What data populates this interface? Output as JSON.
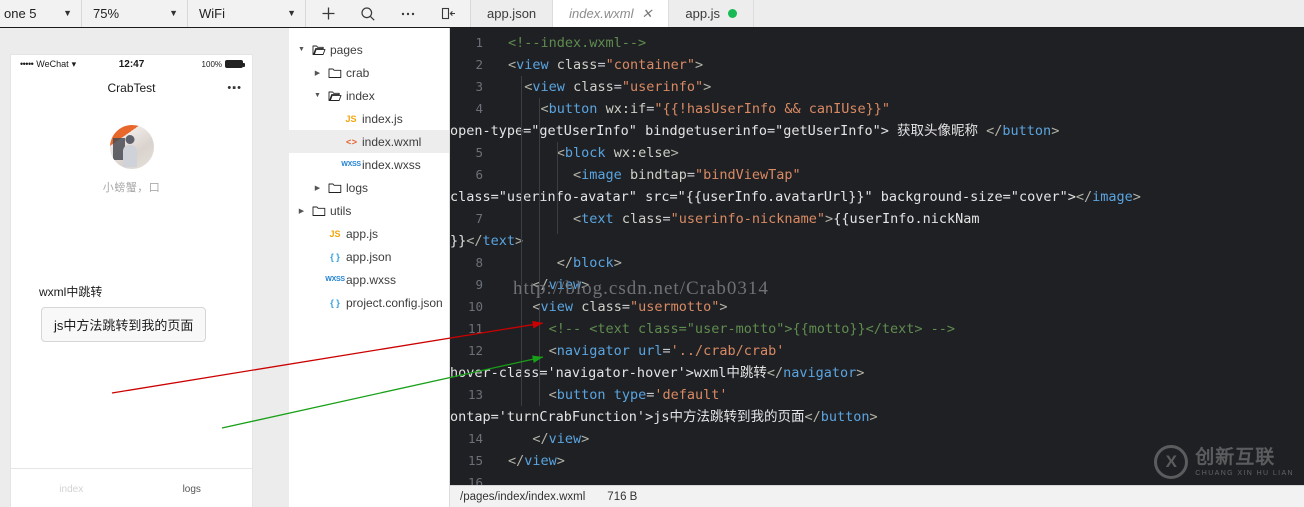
{
  "toolbar": {
    "device": "one 5",
    "zoom": "75%",
    "network": "WiFi",
    "icons": {
      "add": "plus-icon",
      "search": "search-icon",
      "more": "more-icon",
      "collapse": "collapse-panel-icon"
    }
  },
  "tabs": [
    {
      "label": "app.json",
      "active": false,
      "closable": false,
      "modified": false
    },
    {
      "label": "index.wxml",
      "active": true,
      "closable": true,
      "close_glyph": "✕",
      "modified": false
    },
    {
      "label": "app.js",
      "active": false,
      "closable": false,
      "modified": true
    }
  ],
  "simulator": {
    "status": {
      "carrier": "WeChat",
      "signal_dots": "•••••",
      "wifi_glyph": "▾",
      "time": "12:47",
      "battery": "100%"
    },
    "nav_title": "CrabTest",
    "menu_dots": "•▪•",
    "nickname": "小螃蟹，口",
    "wxml_link": "wxml中跳转",
    "js_button": "js中方法跳转到我的页面",
    "tabbar": [
      {
        "label": "index",
        "active": false
      },
      {
        "label": "logs",
        "active": true
      }
    ]
  },
  "filetree": [
    {
      "label": "pages",
      "type": "folder",
      "open": true,
      "depth": 0,
      "selected": false
    },
    {
      "label": "crab",
      "type": "folder",
      "open": false,
      "depth": 1,
      "selected": false
    },
    {
      "label": "index",
      "type": "folder",
      "open": true,
      "depth": 1,
      "selected": false
    },
    {
      "label": "index.js",
      "type": "js",
      "depth": 2,
      "selected": false
    },
    {
      "label": "index.wxml",
      "type": "wxml",
      "depth": 2,
      "selected": true
    },
    {
      "label": "index.wxss",
      "type": "wxss",
      "depth": 2,
      "selected": false
    },
    {
      "label": "logs",
      "type": "folder",
      "open": false,
      "depth": 1,
      "selected": false
    },
    {
      "label": "utils",
      "type": "folder",
      "open": false,
      "depth": 0,
      "selected": false
    },
    {
      "label": "app.js",
      "type": "js",
      "depth": 1,
      "selected": false
    },
    {
      "label": "app.json",
      "type": "json",
      "depth": 1,
      "selected": false
    },
    {
      "label": "app.wxss",
      "type": "wxss",
      "depth": 1,
      "selected": false
    },
    {
      "label": "project.config.json",
      "type": "json",
      "depth": 1,
      "selected": false
    }
  ],
  "file_icon_glyphs": {
    "js": "JS",
    "wxml": "< >",
    "wxss": "WXSS",
    "json": "{ }"
  },
  "editor": {
    "lines": [
      {
        "n": "1",
        "t": "<!--index.wxml-->"
      },
      {
        "n": "2",
        "t": "<view class=\"container\">"
      },
      {
        "n": "3",
        "t": "  <view class=\"userinfo\">"
      },
      {
        "n": "4",
        "t": "    <button wx:if=\"{{!hasUserInfo && canIUse}}\" open-type=\"getUserInfo\" bindgetuserinfo=\"getUserInfo\"> 获取头像昵称 </button>"
      },
      {
        "n": "5",
        "t": "      <block wx:else>"
      },
      {
        "n": "6",
        "t": "        <image bindtap=\"bindViewTap\" class=\"userinfo-avatar\" src=\"{{userInfo.avatarUrl}}\" background-size=\"cover\"></image>"
      },
      {
        "n": "7",
        "t": "        <text class=\"userinfo-nickname\">{{userInfo.nickName}}</text>"
      },
      {
        "n": "8",
        "t": "      </block>"
      },
      {
        "n": "9",
        "t": "   </view>"
      },
      {
        "n": "10",
        "t": "   <view class=\"usermotto\">"
      },
      {
        "n": "11",
        "t": "     <!-- <text class=\"user-motto\">{{motto}}</text> -->"
      },
      {
        "n": "12",
        "t": "     <navigator url='../crab/crab' hover-class='navigator-hover'>wxml中跳转</navigator>"
      },
      {
        "n": "13",
        "t": "     <button type='default' ontap='turnCrabFunction'>js中方法跳转到我的页面</button>"
      },
      {
        "n": "14",
        "t": "   </view>"
      },
      {
        "n": "15",
        "t": "</view>"
      },
      {
        "n": "16",
        "t": ""
      }
    ]
  },
  "watermark": {
    "url": "http://blog.csdn.net/Crab0314",
    "logo_cn": "创新互联",
    "logo_en": "CHUANG XIN HU LIAN",
    "logo_mark": "X"
  },
  "statusbar": {
    "path": "/pages/index/index.wxml",
    "size": "716 B"
  },
  "colors": {
    "editor_bg": "#1f2024",
    "comment": "#5f8c4f",
    "tag": "#5aa5e0",
    "string": "#d98a63",
    "modified_dot": "#19b955",
    "selection": "#ededed"
  }
}
